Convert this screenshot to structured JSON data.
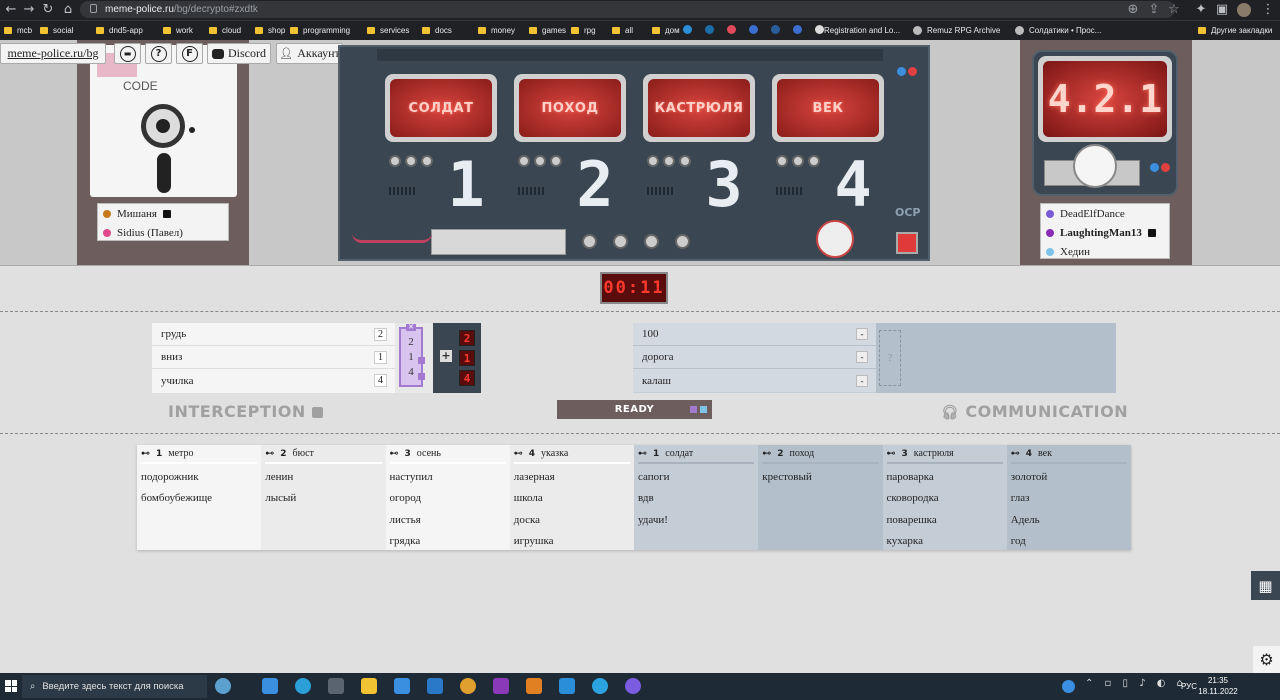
{
  "browser": {
    "url_host": "meme-police.ru",
    "url_path": "/bg/decrypto#zxdtk",
    "bookmarks": [
      {
        "label": "mcb",
        "kind": "folder"
      },
      {
        "label": "social",
        "kind": "folder"
      },
      {
        "label": "dnd5-app",
        "kind": "folder"
      },
      {
        "label": "work",
        "kind": "folder"
      },
      {
        "label": "cloud",
        "kind": "folder"
      },
      {
        "label": "shop",
        "kind": "folder"
      },
      {
        "label": "programming",
        "kind": "folder"
      },
      {
        "label": "services",
        "kind": "folder"
      },
      {
        "label": "docs",
        "kind": "folder"
      },
      {
        "label": "money",
        "kind": "folder"
      },
      {
        "label": "games",
        "kind": "folder"
      },
      {
        "label": "rpg",
        "kind": "folder"
      },
      {
        "label": "all",
        "kind": "folder"
      },
      {
        "label": "дом",
        "kind": "folder"
      },
      {
        "label": "Registration and Lo...",
        "kind": "site"
      },
      {
        "label": "Remuz RPG Archive",
        "kind": "site"
      },
      {
        "label": "Солдатики • Прос...",
        "kind": "site"
      },
      {
        "label": "Другие закладки",
        "kind": "folder"
      }
    ]
  },
  "toolbar": {
    "site_link": "meme-police.ru/bg",
    "discord": "Discord",
    "account": "Аккаунт",
    "help_symbol": "?",
    "f_symbol": "F"
  },
  "left_team": {
    "floppy_label": "CODE",
    "players": [
      {
        "name": "Мишаня",
        "color": "#c77a1a",
        "locked": true
      },
      {
        "name": "Sidius (Павел)",
        "color": "#e04a8a",
        "locked": false
      }
    ]
  },
  "machine": {
    "words": [
      "СОЛДАТ",
      "ПОХОД",
      "КАСТРЮЛЯ",
      "ВЕК"
    ],
    "numbers": [
      "1",
      "2",
      "3",
      "4"
    ],
    "brand": "OCP"
  },
  "right_team": {
    "monitor_code": "4.2.1",
    "players": [
      {
        "name": "DeadElfDance",
        "color": "#7a5cd6",
        "locked": false,
        "bold": false
      },
      {
        "name": "LaughtingMan13",
        "color": "#8a2bb5",
        "locked": true,
        "bold": true
      },
      {
        "name": "Хедин",
        "color": "#7ec3e8",
        "locked": false,
        "bold": false
      }
    ]
  },
  "timer": "00:11",
  "interception": {
    "title": "INTERCEPTION",
    "clues": [
      {
        "word": "грудь",
        "num": "2"
      },
      {
        "word": "вниз",
        "num": "1"
      },
      {
        "word": "училка",
        "num": "4"
      }
    ],
    "selected_code": [
      "2",
      "1",
      "4"
    ],
    "red_digits": [
      "2",
      "1",
      "4"
    ]
  },
  "communication": {
    "title": "COMMUNICATION",
    "clues": [
      {
        "word": "100"
      },
      {
        "word": "дорога"
      },
      {
        "word": "калаш"
      }
    ],
    "placeholder": "?"
  },
  "ready_label": "READY",
  "keywords_left": [
    {
      "num": "1",
      "word": "метро",
      "items": [
        "подорожник",
        "бомбоубежище"
      ]
    },
    {
      "num": "2",
      "word": "бюст",
      "items": [
        "ленин",
        "лысый"
      ]
    },
    {
      "num": "3",
      "word": "осень",
      "items": [
        "наступил",
        "огород",
        "листья",
        "грядка"
      ]
    },
    {
      "num": "4",
      "word": "указка",
      "items": [
        "лазерная",
        "школа",
        "доска",
        "игрушка"
      ]
    }
  ],
  "keywords_right": [
    {
      "num": "1",
      "word": "солдат",
      "items": [
        "сапоги",
        "вдв",
        "удачи!"
      ]
    },
    {
      "num": "2",
      "word": "поход",
      "items": [
        "крестовый"
      ]
    },
    {
      "num": "3",
      "word": "кастрюля",
      "items": [
        "пароварка",
        "сковородка",
        "поварешка",
        "кухарка"
      ]
    },
    {
      "num": "4",
      "word": "век",
      "items": [
        "золотой",
        "глаз",
        "Адель",
        "год"
      ]
    }
  ],
  "taskbar": {
    "search_placeholder": "Введите здесь текст для поиска",
    "lang": "РУС",
    "time": "21:35",
    "date": "18.11.2022"
  }
}
